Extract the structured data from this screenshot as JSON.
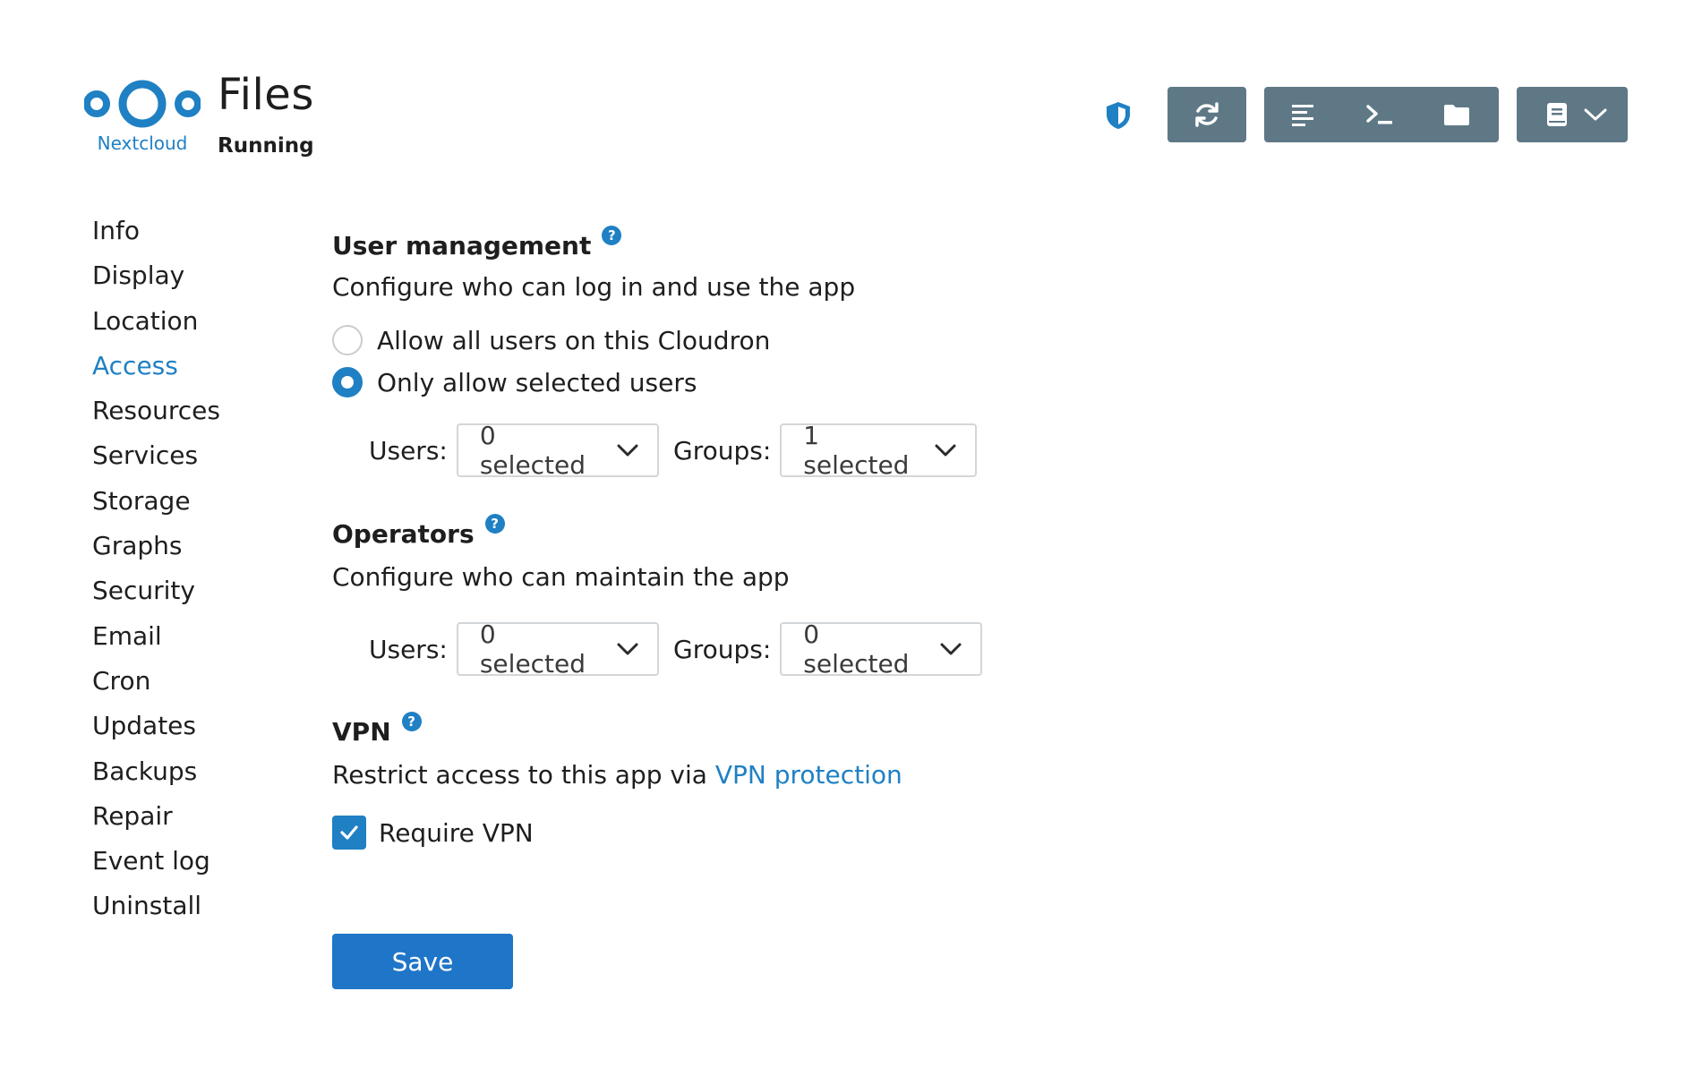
{
  "header": {
    "logo_text": "Nextcloud",
    "title": "Files",
    "status": "Running",
    "icons": {
      "shield": "shield-icon",
      "restart": "refresh-icon",
      "logs": "logs-icon",
      "terminal": "terminal-icon",
      "files": "folder-icon",
      "docs": "book-icon",
      "menu": "chevron-down-icon"
    }
  },
  "sidebar": {
    "items": [
      {
        "label": "Info"
      },
      {
        "label": "Display"
      },
      {
        "label": "Location"
      },
      {
        "label": "Access",
        "active": true
      },
      {
        "label": "Resources"
      },
      {
        "label": "Services"
      },
      {
        "label": "Storage"
      },
      {
        "label": "Graphs"
      },
      {
        "label": "Security"
      },
      {
        "label": "Email"
      },
      {
        "label": "Cron"
      },
      {
        "label": "Updates"
      },
      {
        "label": "Backups"
      },
      {
        "label": "Repair"
      },
      {
        "label": "Event log"
      },
      {
        "label": "Uninstall"
      }
    ]
  },
  "user_management": {
    "title": "User management",
    "help": "?",
    "description": "Configure who can log in and use the app",
    "options": {
      "all_users": {
        "label": "Allow all users on this Cloudron",
        "checked": false
      },
      "selected_users": {
        "label": "Only allow selected users",
        "checked": true
      }
    },
    "users_label": "Users:",
    "users_value": "0 selected",
    "groups_label": "Groups:",
    "groups_value": "1 selected"
  },
  "operators": {
    "title": "Operators",
    "help": "?",
    "description": "Configure who can maintain the app",
    "users_label": "Users:",
    "users_value": "0 selected",
    "groups_label": "Groups:",
    "groups_value": "0 selected"
  },
  "vpn": {
    "title": "VPN",
    "help": "?",
    "description_prefix": "Restrict access to this app via ",
    "description_link": "VPN protection",
    "require_label": "Require VPN",
    "require_checked": true
  },
  "actions": {
    "save_label": "Save"
  },
  "colors": {
    "accent": "#1f80c4",
    "toolbar": "#5f7886",
    "save": "#1f75c7"
  }
}
